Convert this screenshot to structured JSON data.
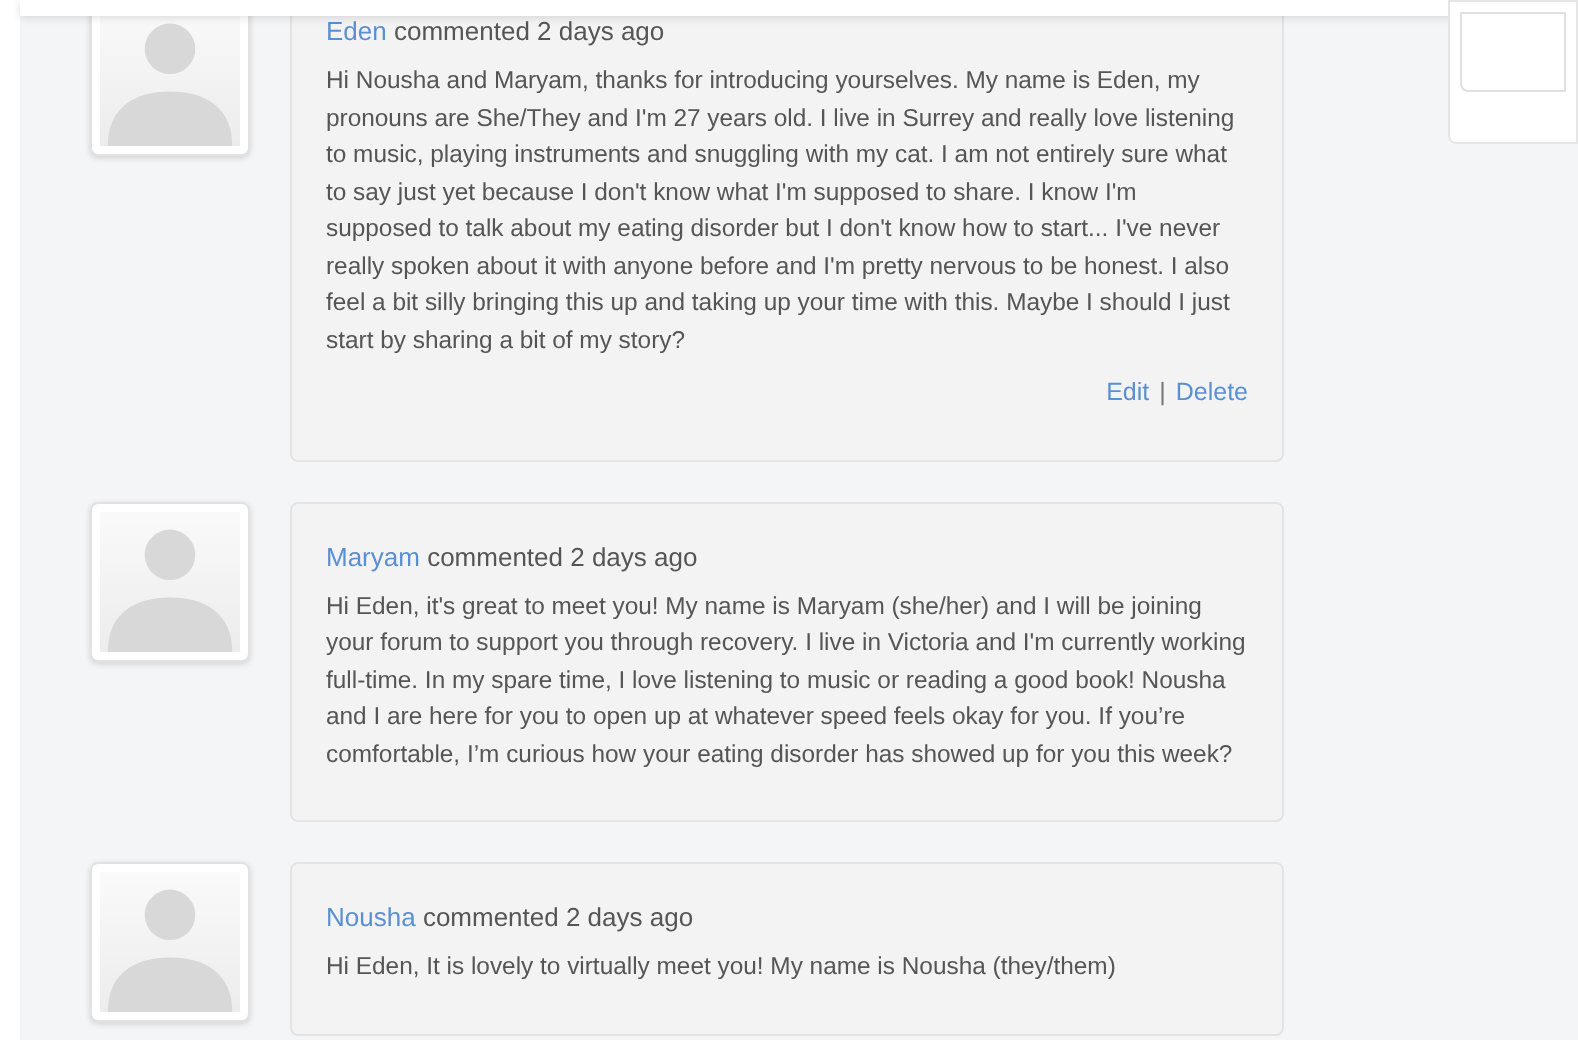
{
  "comments": [
    {
      "author": "Eden",
      "meta": "commented 2 days ago",
      "body": "Hi Nousha and Maryam, thanks for introducing yourselves. My name is Eden, my pronouns are She/They and I'm 27 years old. I live in Surrey and really love listening to music, playing instruments and snuggling with my cat. I am not entirely sure what to say just yet because I don't know what I'm supposed to share. I know I'm supposed to talk about my eating disorder but I don't know how to start... I've never really spoken about it with anyone before and I'm pretty nervous to be honest. I also feel a bit silly bringing this up and taking up your time with this. Maybe I should I just start by sharing a bit of my story?",
      "actions": [
        "Edit",
        "Delete"
      ],
      "separator": "|"
    },
    {
      "author": "Maryam",
      "meta": "commented 2 days ago",
      "body": "Hi Eden, it's great to meet you! My name is Maryam (she/her) and I will be joining your forum to support you through recovery. I live in Victoria and I'm currently working full-time. In my spare time, I love listening to music or reading a good book! Nousha and I are here for you to open up at whatever speed feels okay for you. If you’re comfortable, I’m curious how your eating disorder has showed up for you this week?"
    },
    {
      "author": "Nousha",
      "meta": "commented 2 days ago",
      "body": "Hi Eden, It is lovely to virtually meet you! My name is Nousha (they/them)"
    }
  ]
}
